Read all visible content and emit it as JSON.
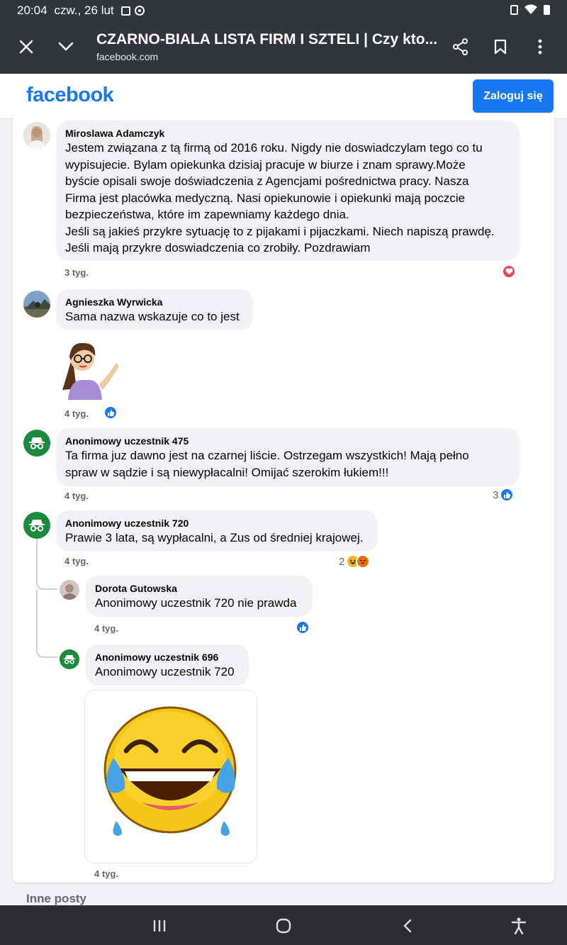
{
  "status_bar": {
    "time": "20:04",
    "date": "czw., 26 lut"
  },
  "browser": {
    "title": "CZARNO-BIALA LISTA FIRM I SZTELI | Czy kto...",
    "url": "facebook.com",
    "icons": [
      "close-icon",
      "chevron-down-icon",
      "share-icon",
      "bookmark-icon",
      "more-vert-icon"
    ]
  },
  "fb_header": {
    "logo": "facebook",
    "login_label": "Zaloguj się",
    "brand_color": "#1877f2"
  },
  "comments": [
    {
      "author": "Miroslawa Adamczyk",
      "text": "Jestem związana z tą firmą od 2016 roku. Nigdy nie doswiadczylam tego co tu\nwypisujecie. Bylam opiekunka dzisiaj pracuje w biurze i znam sprawy.Może\nbyście opisali swoje doświadczenia z Agencjami pośrednictwa pracy. Nasza\nFirma jest placówka medyczną. Nasi opiekunowie i opiekunki mają poczcie\nbezpieczeństwa, które im zapewniamy każdego dnia.\nJeśli są jakieś przykre sytuację to z pijakami i pijaczkami. Niech napiszą prawdę.\nJeśli mają przykre doswiadczenia co zrobiły. Pozdrawiam",
      "time": "3 tyg.",
      "reactions": [
        "love"
      ]
    },
    {
      "author": "Agnieszka Wyrwicka",
      "text": "Sama nazwa wskazuje co to jest",
      "time": "4 tyg.",
      "reactions": [
        "like"
      ],
      "sticker": "woman-shrug-sticker"
    },
    {
      "author": "Anonimowy uczestnik 475",
      "text": "Ta firma juz dawno jest na czarnej liście. Ostrzegam wszystkich! Mają pełno\nspraw w sądzie i są niewypłacalni! Omijać szerokim łukiem!!!",
      "time": "4 tyg.",
      "reaction_count": "3",
      "reactions": [
        "like"
      ]
    },
    {
      "author": "Anonimowy uczestnik 720",
      "text": "Prawie 3 lata, są wypłacalni, a Zus od średniej krajowej.",
      "time": "4 tyg.",
      "reaction_count": "2",
      "reactions": [
        "haha",
        "angry"
      ]
    }
  ],
  "replies": [
    {
      "author": "Dorota Gutowska",
      "text": "Anonimowy uczestnik 720 nie prawda",
      "time": "4 tyg.",
      "reactions": [
        "like"
      ]
    },
    {
      "author": "Anonimowy uczestnik 696",
      "text": "Anonimowy uczestnik 720",
      "time": "4 tyg.",
      "sticker": "laughing-tears-emoji-sticker"
    }
  ],
  "footer": {
    "other_posts": "Inne posty"
  },
  "nav": [
    "recents-icon",
    "home-icon",
    "back-icon",
    "accessibility-icon"
  ]
}
